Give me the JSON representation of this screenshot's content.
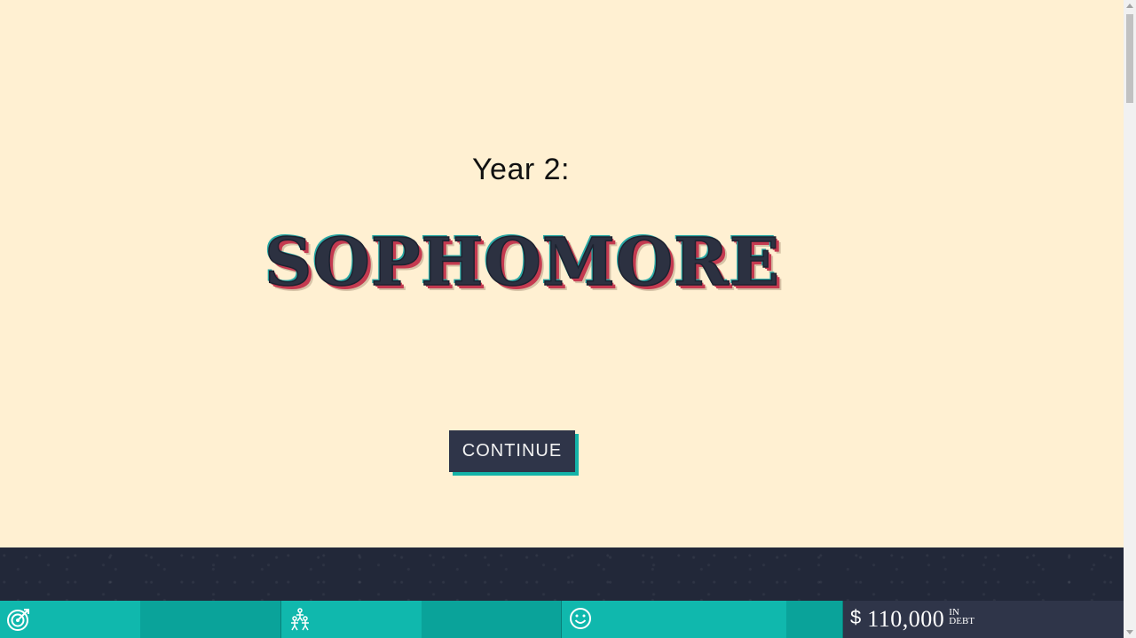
{
  "screen": {
    "year_label": "Year 2:",
    "level_title": "SOPHOMORE",
    "continue_label": "CONTINUE"
  },
  "status_bar": {
    "stats": [
      {
        "name": "goals",
        "icon": "target-icon",
        "level": 0.5
      },
      {
        "name": "social",
        "icon": "people-icon",
        "level": 0.5
      },
      {
        "name": "happiness",
        "icon": "smiley-icon",
        "level": 0.8
      }
    ],
    "debt": {
      "currency": "$",
      "amount": "110,000",
      "unit_top": "IN",
      "unit_bottom": "DEBT"
    }
  },
  "colors": {
    "background": "#fff0d2",
    "stat_fill": "#10b8ad",
    "stat_track": "#0aa39a",
    "debt_bg": "#2f3549",
    "button_bg": "#2f3549",
    "button_shadow": "#14b3a8",
    "title_shadow": "#c43a50"
  }
}
